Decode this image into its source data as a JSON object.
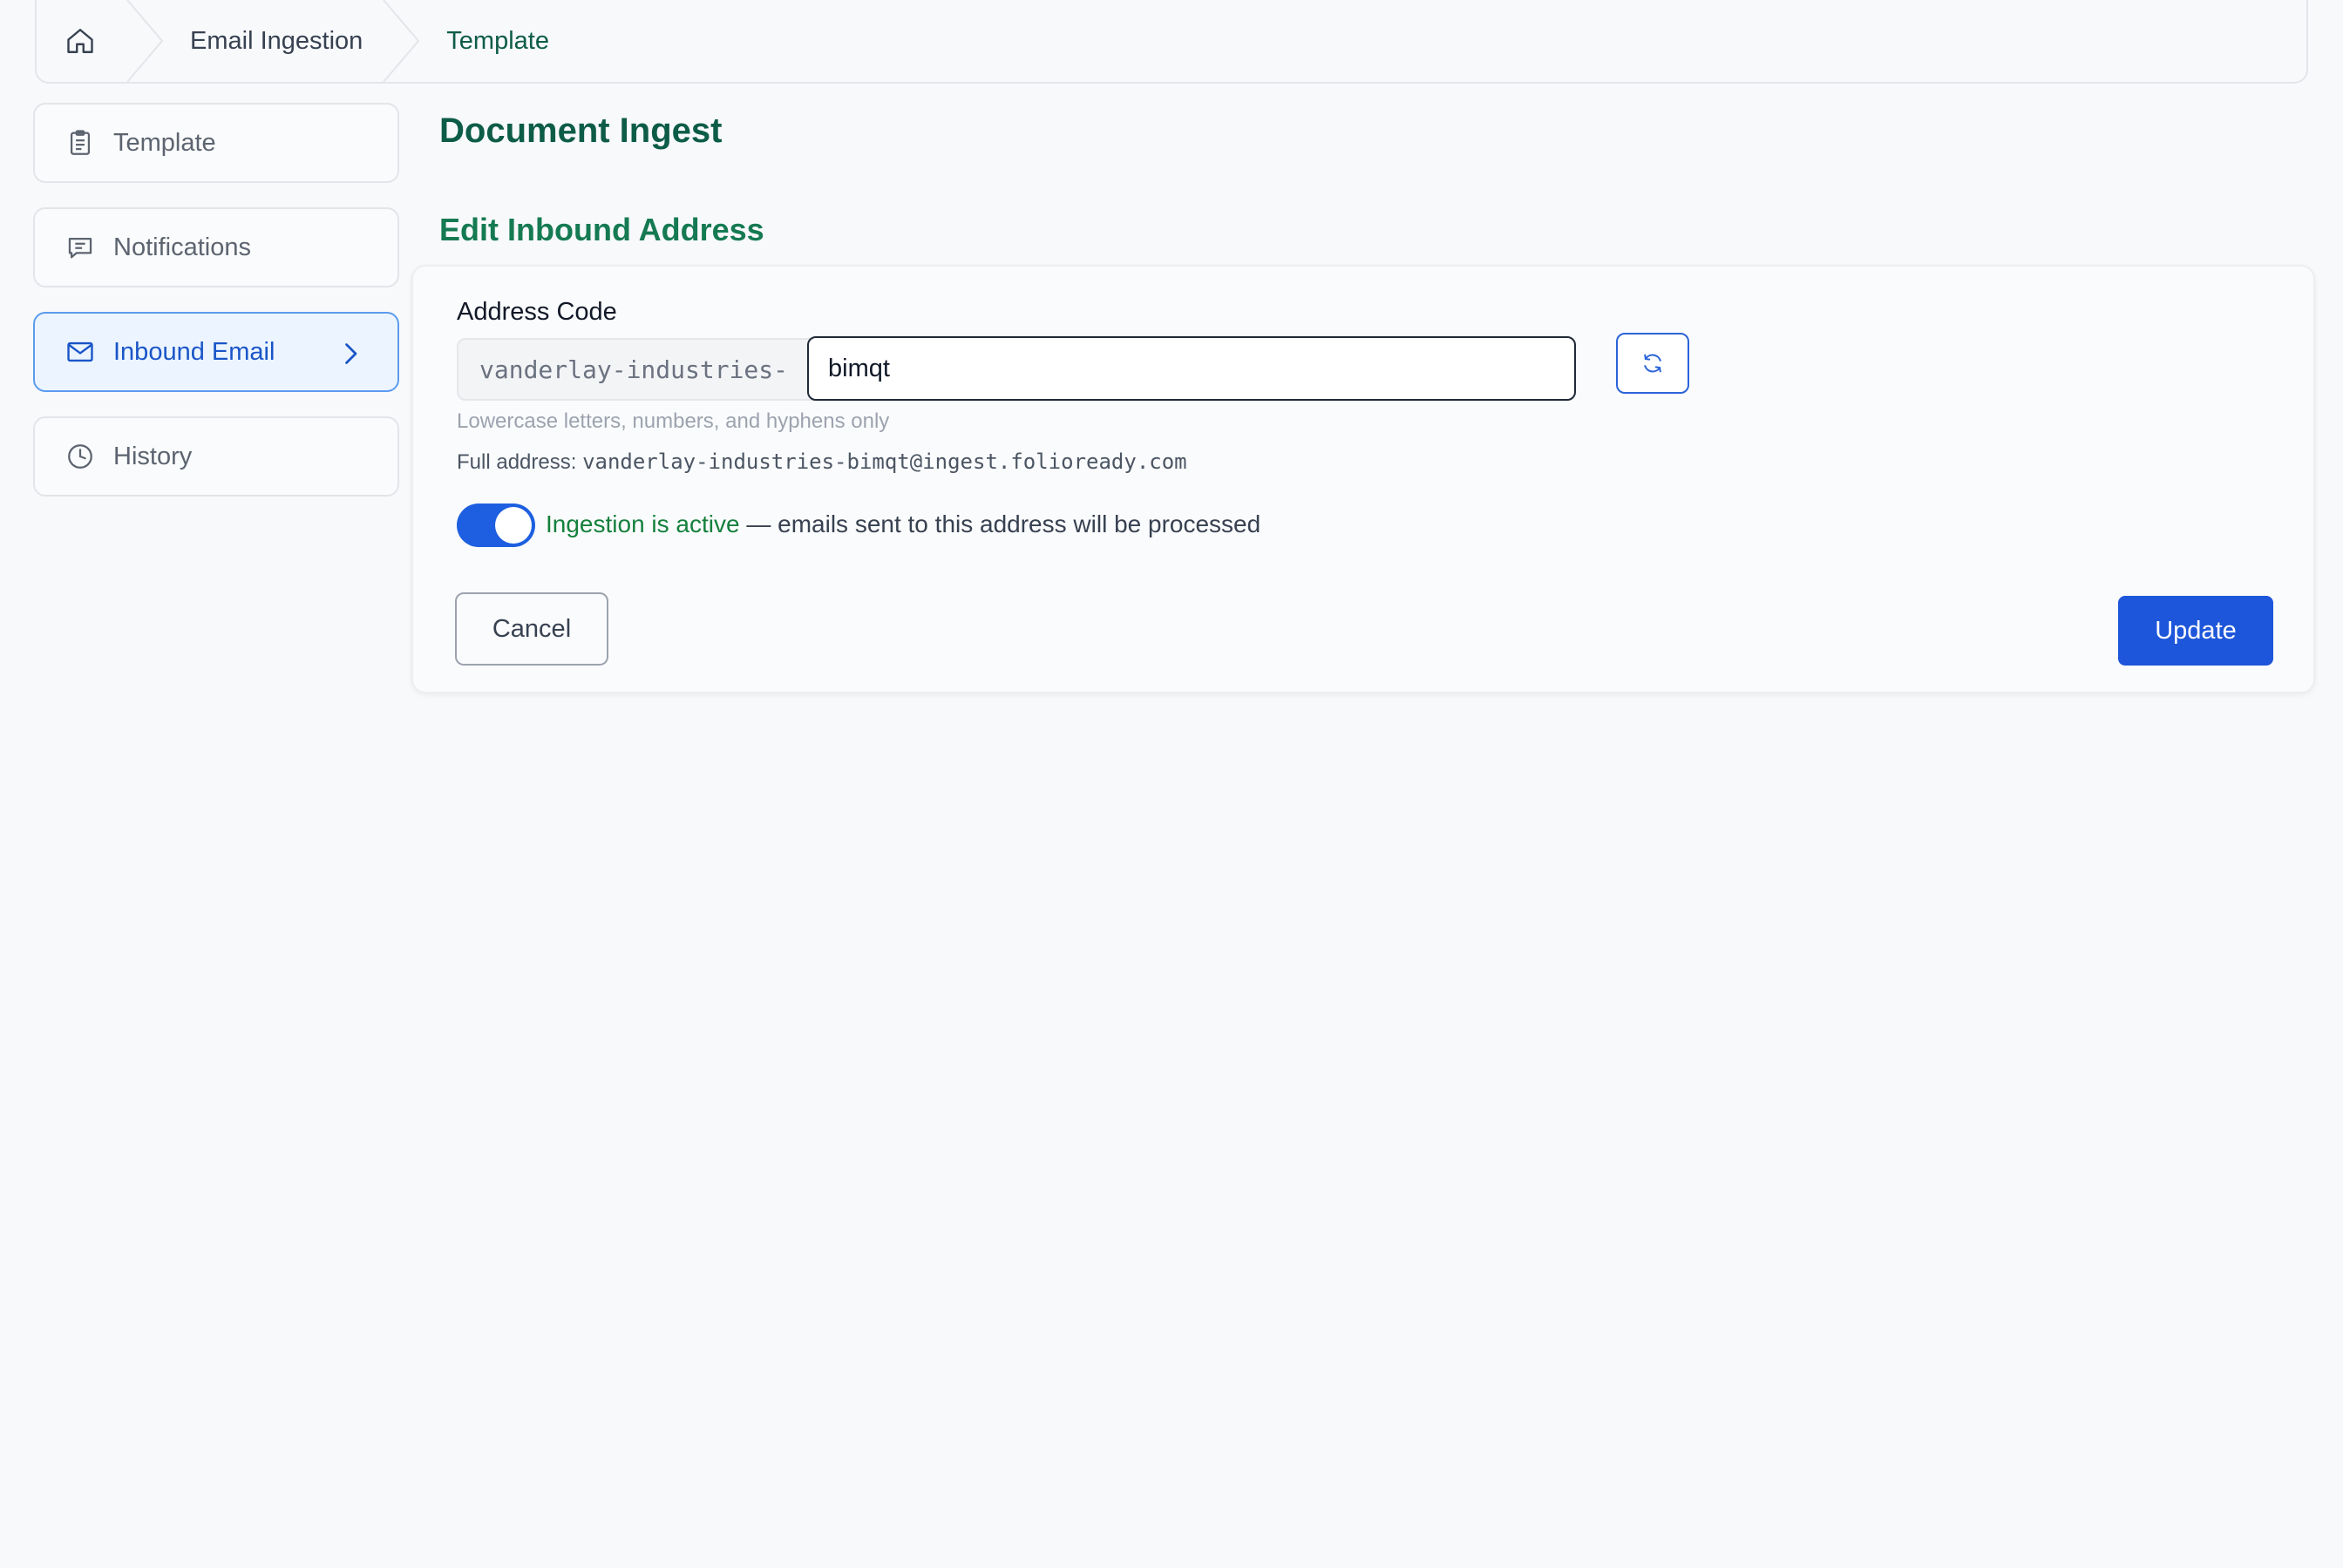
{
  "breadcrumb": {
    "home_icon": "home-icon",
    "items": [
      "Email Ingestion",
      "Template"
    ]
  },
  "sidebar": {
    "items": [
      {
        "label": "Template",
        "icon": "clipboard-icon"
      },
      {
        "label": "Notifications",
        "icon": "message-icon"
      },
      {
        "label": "Inbound Email",
        "icon": "mail-icon",
        "active": true
      },
      {
        "label": "History",
        "icon": "clock-icon"
      }
    ]
  },
  "main": {
    "page_title": "Document Ingest",
    "section_title": "Edit Inbound Address",
    "form": {
      "label": "Address Code",
      "prefix": "vanderlay-industries-",
      "code_value": "bimqt",
      "hint": "Lowercase letters, numbers, and hyphens only",
      "full_address_label": "Full address:",
      "full_address": "vanderlay-industries-bimqt@ingest.folioready.com",
      "toggle_on": true,
      "toggle_status": "Ingestion is active",
      "toggle_desc": " — emails sent to this address will be processed",
      "regenerate_icon": "refresh-icon"
    },
    "buttons": {
      "cancel": "Cancel",
      "update": "Update"
    }
  },
  "colors": {
    "accent": "#1d56da",
    "title_green": "#0d5c47",
    "active_green": "#15803d"
  }
}
